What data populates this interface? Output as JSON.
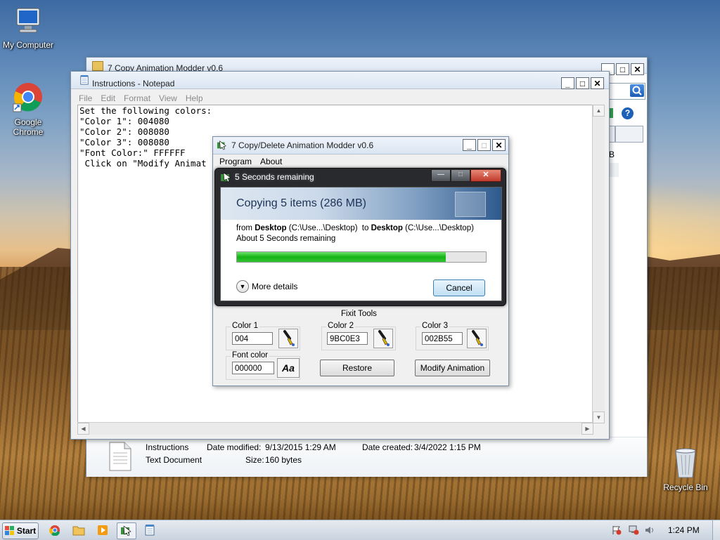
{
  "desktop": {
    "icons": [
      {
        "label": "My Computer"
      },
      {
        "label": "Google Chrome"
      },
      {
        "label": "Recycle Bin"
      }
    ]
  },
  "explorer": {
    "title": "7 Copy Animation Modder v0.6",
    "details": {
      "name": "Instructions",
      "type": "Text Document",
      "date_modified_label": "Date modified:",
      "date_modified": "9/13/2015 1:29 AM",
      "size_label": "Size:",
      "size": "160 bytes",
      "date_created_label": "Date created:",
      "date_created": "3/4/2022 1:15 PM"
    },
    "partial_label": "B"
  },
  "notepad": {
    "title": "Instructions - Notepad",
    "menu": [
      "File",
      "Edit",
      "Format",
      "View",
      "Help"
    ],
    "lines": [
      "Set the following colors:",
      "\"Color 1\": 004080",
      "\"Color 2\": 008080",
      "\"Color 3\": 008080",
      "\"Font Color:\" FFFFFF",
      " Click on \"Modify Animat"
    ]
  },
  "modder": {
    "title": "7 Copy/Delete Animation Modder v0.6",
    "menu": [
      "Program",
      "About"
    ],
    "fixit_label": "Fixit Tools",
    "color1": {
      "label": "Color 1",
      "value": "004"
    },
    "color2": {
      "label": "Color 2",
      "value": "9BC0E3"
    },
    "color3": {
      "label": "Color 3",
      "value": "002B55"
    },
    "font_color": {
      "label": "Font color",
      "value": "000000",
      "button": "Aa"
    },
    "restore_label": "Restore",
    "modify_label": "Modify Animation"
  },
  "copy_dialog": {
    "title": "5 Seconds remaining",
    "heading": "Copying 5 items (286 MB)",
    "from_word": "from",
    "from_name": "Desktop",
    "from_path": "(C:\\Use...\\Desktop)",
    "to_word": "to",
    "to_name": "Desktop",
    "to_path": "(C:\\Use...\\Desktop)",
    "remaining": "About 5 Seconds remaining",
    "progress": 0.84,
    "more_details": "More details",
    "cancel": "Cancel"
  },
  "taskbar": {
    "start": "Start",
    "time": "1:24 PM"
  }
}
